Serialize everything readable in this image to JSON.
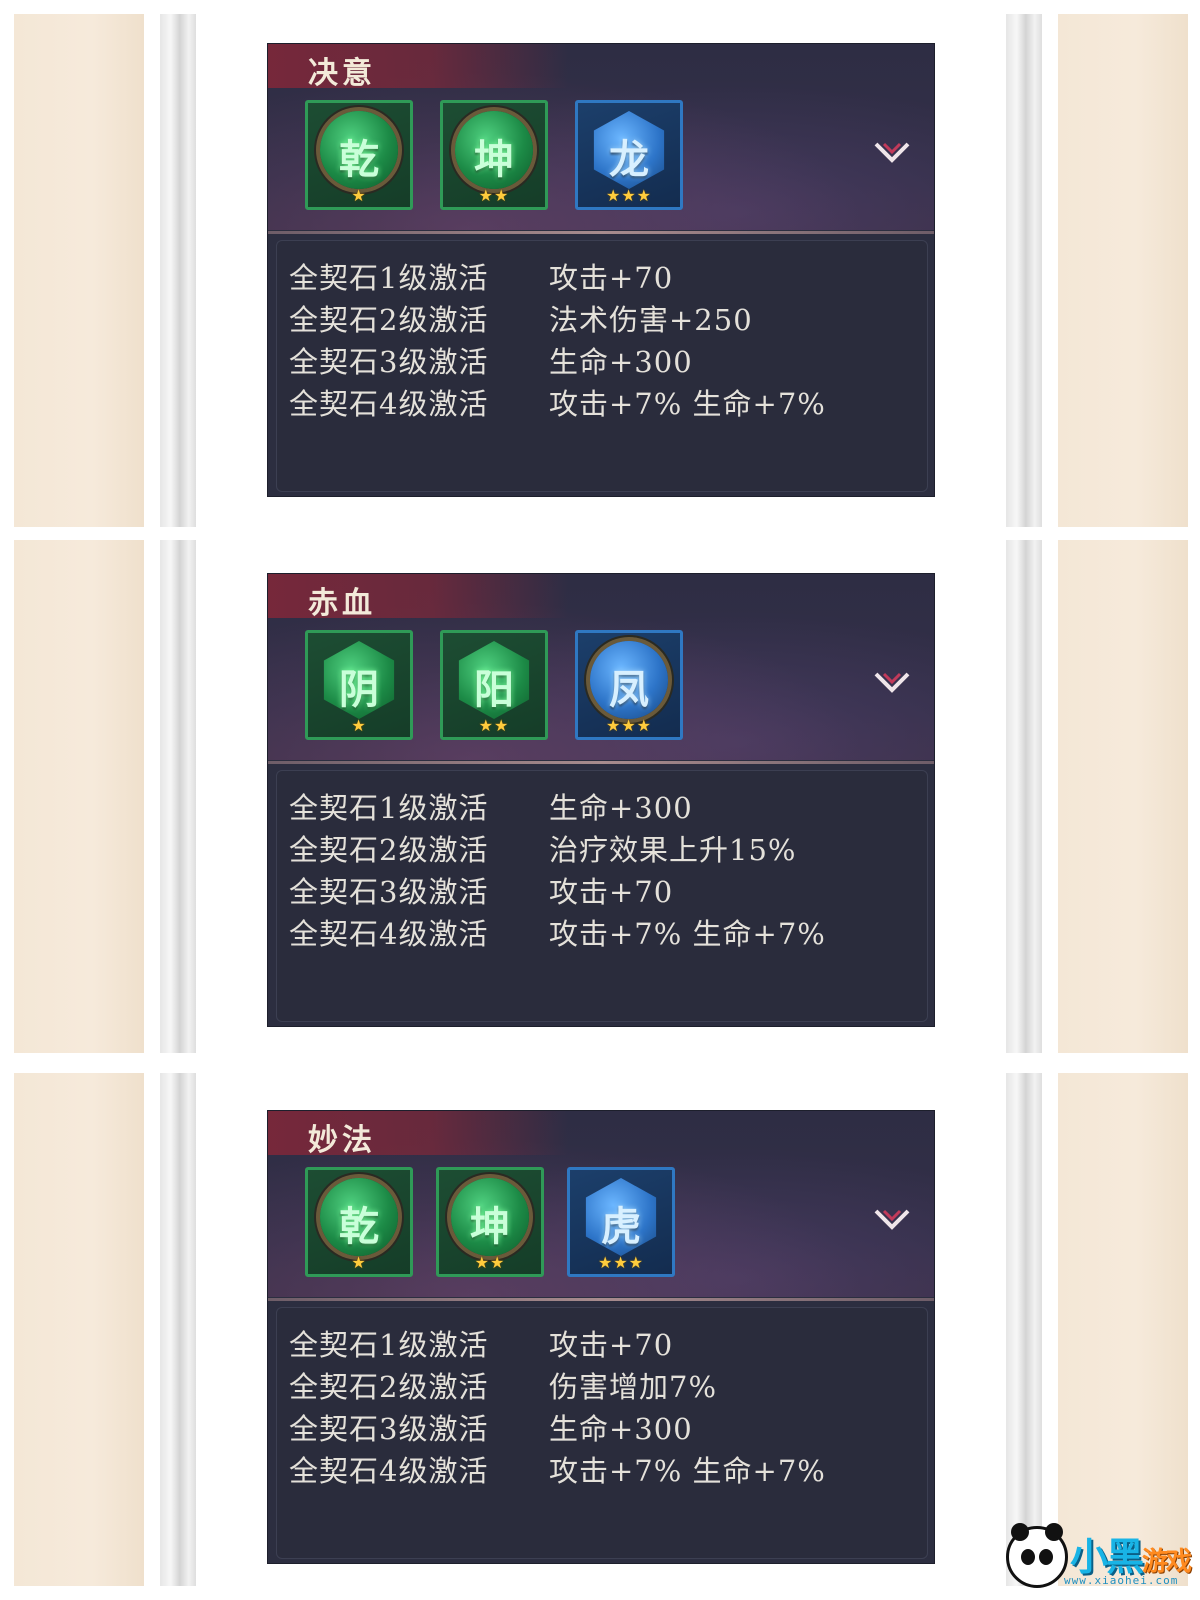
{
  "panels": [
    {
      "title": "决意",
      "stones": [
        {
          "char": "乾",
          "color": "green",
          "shape": "round",
          "stars": "★"
        },
        {
          "char": "坤",
          "color": "green",
          "shape": "round",
          "stars": "★★"
        },
        {
          "char": "龙",
          "color": "blue",
          "shape": "hex",
          "stars": "★★★"
        }
      ],
      "effects": [
        {
          "activation": "全契石1级激活",
          "bonus": "攻击+70"
        },
        {
          "activation": "全契石2级激活",
          "bonus": "法术伤害+250"
        },
        {
          "activation": "全契石3级激活",
          "bonus": "生命+300"
        },
        {
          "activation": "全契石4级激活",
          "bonus": "攻击+7%  生命+7%"
        }
      ]
    },
    {
      "title": "赤血",
      "stones": [
        {
          "char": "阴",
          "color": "green",
          "shape": "hex",
          "stars": "★"
        },
        {
          "char": "阳",
          "color": "green",
          "shape": "hex",
          "stars": "★★"
        },
        {
          "char": "凤",
          "color": "blue",
          "shape": "round",
          "stars": "★★★"
        }
      ],
      "effects": [
        {
          "activation": "全契石1级激活",
          "bonus": "生命+300"
        },
        {
          "activation": "全契石2级激活",
          "bonus": "治疗效果上升15%"
        },
        {
          "activation": "全契石3级激活",
          "bonus": "攻击+70"
        },
        {
          "activation": "全契石4级激活",
          "bonus": "攻击+7%  生命+7%"
        }
      ]
    },
    {
      "title": "妙法",
      "stones": [
        {
          "char": "乾",
          "color": "green",
          "shape": "round",
          "stars": "★"
        },
        {
          "char": "坤",
          "color": "green",
          "shape": "round",
          "stars": "★★"
        },
        {
          "char": "虎",
          "color": "blue",
          "shape": "hex",
          "stars": "★★★"
        }
      ],
      "effects": [
        {
          "activation": "全契石1级激活",
          "bonus": "攻击+70"
        },
        {
          "activation": "全契石2级激活",
          "bonus": "伤害增加7%"
        },
        {
          "activation": "全契石3级激活",
          "bonus": "生命+300"
        },
        {
          "activation": "全契石4级激活",
          "bonus": "攻击+7%  生命+7%"
        }
      ]
    }
  ],
  "icons": {
    "expand": "chevron-down-icon"
  },
  "colors": {
    "panel_bg": "#2c2e40",
    "title_band": "#7a283a",
    "green_frame": "#2f9a57",
    "blue_frame": "#2f78c2",
    "star": "#ffcc3d",
    "text": "#e4e1da"
  },
  "watermark": {
    "brand": "小黑",
    "brand_suffix": "游戏",
    "url": "www.xiaohei.com"
  }
}
